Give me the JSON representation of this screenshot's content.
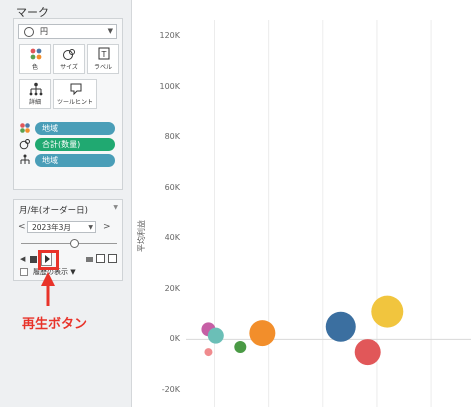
{
  "marks": {
    "title": "マーク",
    "mark_type": "円",
    "cards": [
      {
        "label": "色",
        "icon": "color-dots-icon"
      },
      {
        "label": "サイズ",
        "icon": "size-circles-icon"
      },
      {
        "label": "ラベル",
        "icon": "text-label-icon"
      },
      {
        "label": "詳細",
        "icon": "detail-tree-icon"
      },
      {
        "label": "ツールヒント",
        "icon": "tooltip-bubble-icon"
      }
    ],
    "pills": [
      {
        "label": "地域",
        "color": "#4a9eb8",
        "icon": "color-dots-icon"
      },
      {
        "label": "合計(数量)",
        "color": "#20a971",
        "icon": "size-circles-icon"
      },
      {
        "label": "地域",
        "color": "#4a9eb8",
        "icon": "detail-tree-icon"
      }
    ]
  },
  "pages": {
    "title": "月/年(オーダー日)",
    "current": "2023年3月",
    "slider_fraction": 0.55,
    "history_label": "履歴の表示"
  },
  "annotation": {
    "text": "再生ボタン",
    "color": "#e8332a"
  },
  "chart_data": {
    "type": "scatter",
    "ylabel": "平均利益",
    "y_ticks": [
      "120K",
      "100K",
      "80K",
      "60K",
      "40K",
      "20K",
      "0K",
      "-20K"
    ],
    "ylim": [
      -20000,
      120000
    ],
    "grid": true,
    "points": [
      {
        "x": 0.01,
        "y": 4000,
        "size": 14,
        "color": "#c65fa5"
      },
      {
        "x": 0.04,
        "y": 1500,
        "size": 16,
        "color": "#6bbfb7"
      },
      {
        "x": 0.01,
        "y": -5000,
        "size": 8,
        "color": "#f08b8e"
      },
      {
        "x": 0.14,
        "y": -3000,
        "size": 12,
        "color": "#4a9a45"
      },
      {
        "x": 0.23,
        "y": 2500,
        "size": 26,
        "color": "#f28e2b"
      },
      {
        "x": 0.55,
        "y": 5000,
        "size": 30,
        "color": "#3b6fa0"
      },
      {
        "x": 0.74,
        "y": 11000,
        "size": 32,
        "color": "#f1c53e"
      },
      {
        "x": 0.66,
        "y": -5000,
        "size": 26,
        "color": "#e15759"
      }
    ]
  }
}
